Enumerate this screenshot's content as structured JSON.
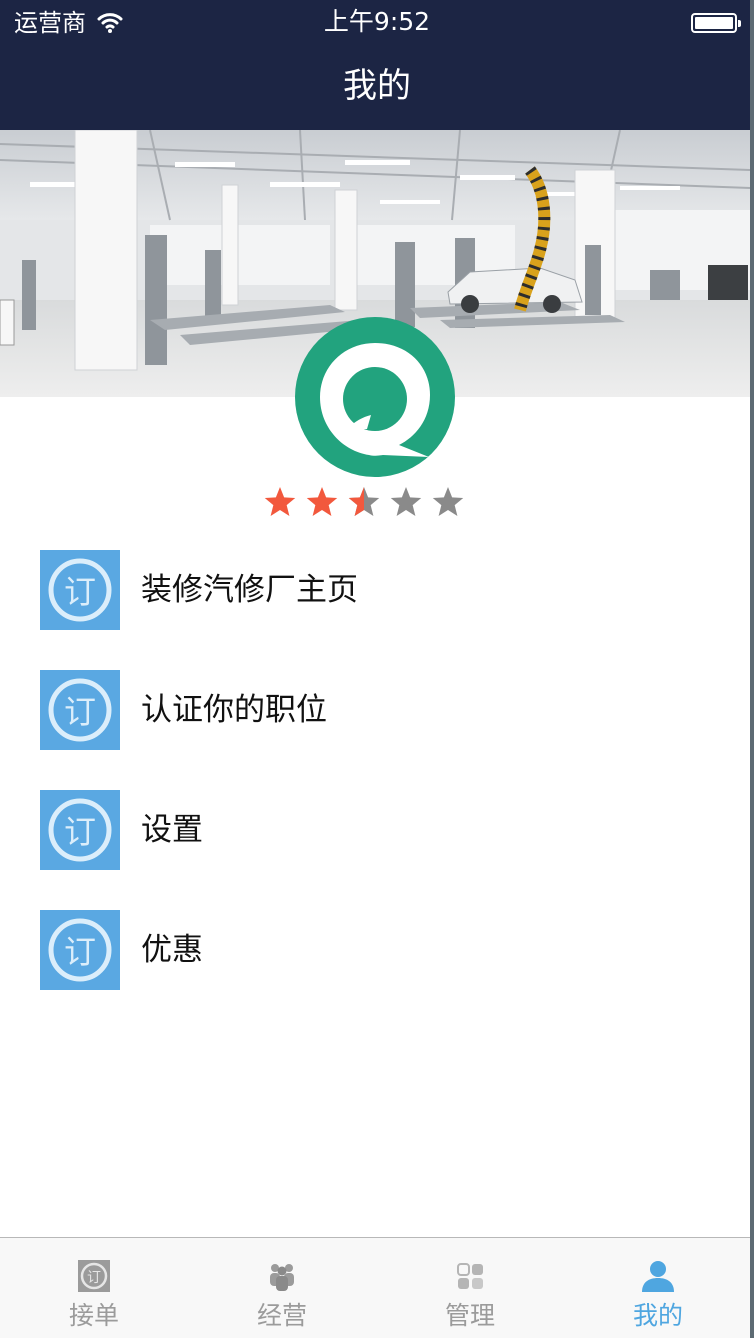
{
  "status_bar": {
    "carrier": "运营商",
    "time": "上午9:52"
  },
  "nav_bar": {
    "title": "我的"
  },
  "profile": {
    "rating": 2.5,
    "rating_max": 5
  },
  "menu": {
    "items": [
      {
        "label": "装修汽修厂主页",
        "icon": "ding-icon"
      },
      {
        "label": "认证你的职位",
        "icon": "ding-icon"
      },
      {
        "label": "设置",
        "icon": "ding-icon"
      },
      {
        "label": "优惠",
        "icon": "ding-icon"
      }
    ]
  },
  "tab_bar": {
    "tabs": [
      {
        "label": "接单",
        "icon": "ding-icon",
        "active": false
      },
      {
        "label": "经营",
        "icon": "people-icon",
        "active": false
      },
      {
        "label": "管理",
        "icon": "grid-icon",
        "active": false
      },
      {
        "label": "我的",
        "icon": "person-icon",
        "active": true
      }
    ]
  },
  "colors": {
    "nav_background": "#1c2544",
    "avatar_green": "#22a37e",
    "star_active": "#f2583d",
    "star_inactive": "#8a8a8a",
    "menu_icon_blue": "#5aa8e2",
    "tab_active": "#4fa6e0",
    "tab_inactive": "#9b9b9b"
  }
}
